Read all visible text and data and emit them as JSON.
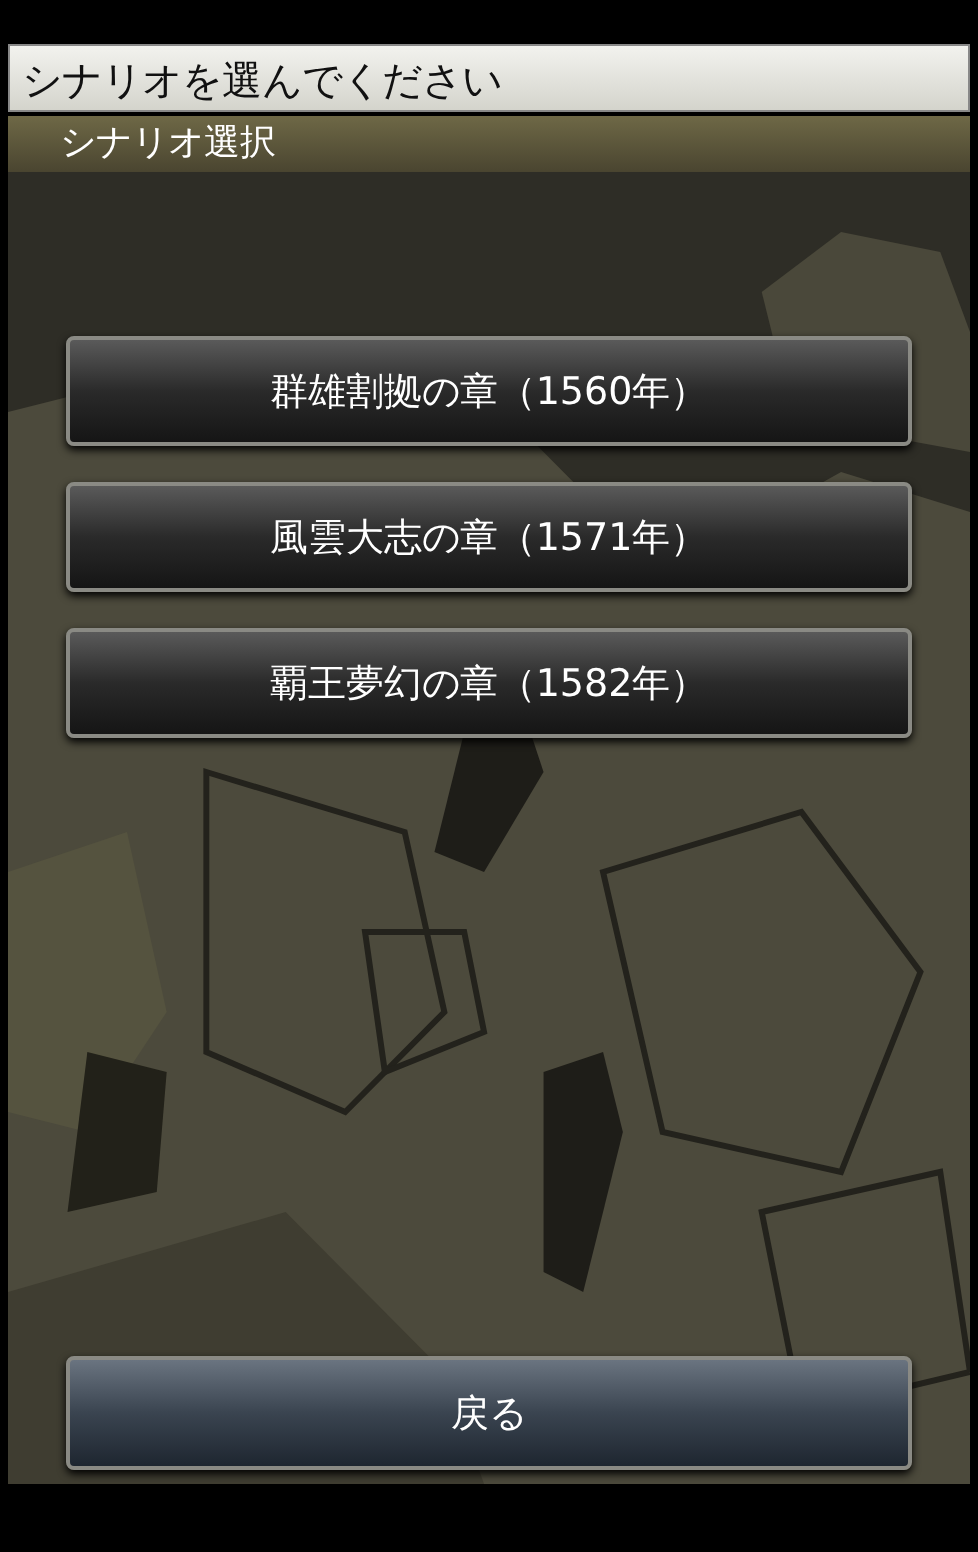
{
  "title_bar": {
    "text": "シナリオを選んでください"
  },
  "header": {
    "title": "シナリオ選択"
  },
  "scenarios": [
    {
      "label": "群雄割拠の章（1560年）"
    },
    {
      "label": "風雲大志の章（1571年）"
    },
    {
      "label": "覇王夢幻の章（1582年）"
    }
  ],
  "back_button": {
    "label": "戻る"
  }
}
